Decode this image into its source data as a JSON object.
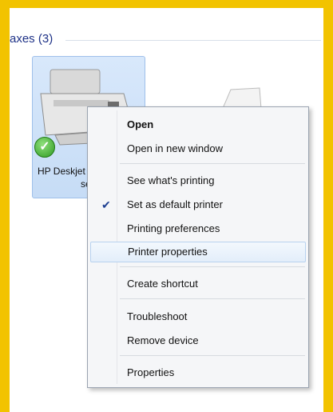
{
  "group": {
    "title": "axes (3)"
  },
  "device": {
    "name_line1": "HP Deskjet",
    "name_line2": "serie"
  },
  "menu": {
    "open": "Open",
    "open_new_window": "Open in new window",
    "see_printing": "See what's printing",
    "set_default": "Set as default printer",
    "printing_prefs": "Printing preferences",
    "printer_props": "Printer properties",
    "create_shortcut": "Create shortcut",
    "troubleshoot": "Troubleshoot",
    "remove_device": "Remove device",
    "properties": "Properties",
    "checked_icon": "check-icon"
  },
  "colors": {
    "frame": "#f2c300",
    "selection": "#c6dcf6",
    "menu_bg": "#f5f6f8",
    "hover_border": "#b8d2ef",
    "header_text": "#1e3287"
  }
}
